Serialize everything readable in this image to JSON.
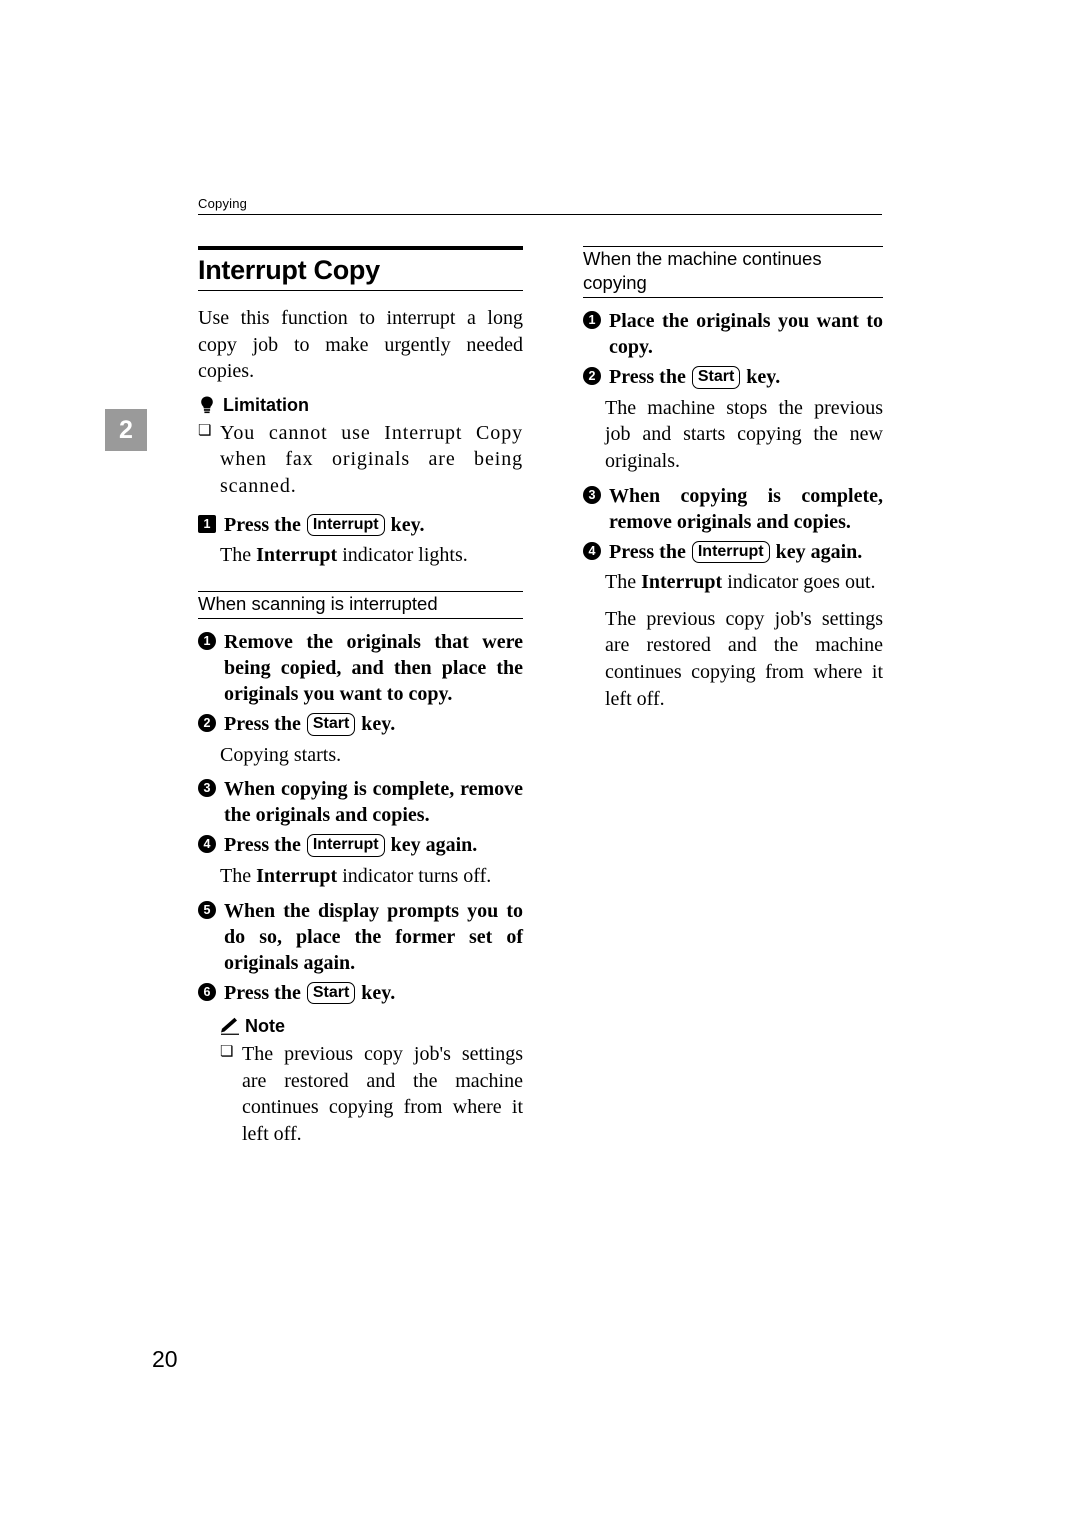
{
  "page": {
    "running_head": "Copying",
    "chapter_tab": "2",
    "page_number": "20"
  },
  "left_column": {
    "title": "Interrupt Copy",
    "intro": "Use this function to interrupt a long copy job to make urgently needed copies.",
    "limitation": {
      "icon": "limitation-bulb-icon",
      "heading": "Limitation",
      "items": [
        "You cannot use Interrupt Copy when fax originals are being scanned."
      ]
    },
    "step_main": {
      "marker": "1",
      "text_before_key": "Press the ",
      "key": "Interrupt",
      "text_after_key": " key."
    },
    "step_main_body_before": "The ",
    "step_main_body_bold": "Interrupt",
    "step_main_body_after": " indicator lights.",
    "section": {
      "heading": "When scanning is interrupted",
      "steps": [
        {
          "marker": "1",
          "text": "Remove the originals that were being copied, and then place the originals you want to copy."
        },
        {
          "marker": "2",
          "text_before_key": "Press the ",
          "key": "Start",
          "text_after_key": " key.",
          "body": "Copying starts."
        },
        {
          "marker": "3",
          "text": "When copying is complete, remove the originals and copies."
        },
        {
          "marker": "4",
          "text_before_key": "Press the ",
          "key": "Interrupt",
          "text_after_key": " key again.",
          "body_before": "The ",
          "body_bold": "Interrupt",
          "body_after": " indicator turns off."
        },
        {
          "marker": "5",
          "text": "When the display prompts you to do so, place the former set of originals again."
        },
        {
          "marker": "6",
          "text_before_key": "Press the ",
          "key": "Start",
          "text_after_key": " key."
        }
      ]
    },
    "note": {
      "icon": "note-pencil-icon",
      "heading": "Note",
      "items": [
        "The previous copy job's settings are restored and the machine continues copying from where it left off."
      ]
    }
  },
  "right_column": {
    "section": {
      "heading": "When the machine continues copying",
      "steps": [
        {
          "marker": "1",
          "text": "Place the originals you want to copy."
        },
        {
          "marker": "2",
          "text_before_key": "Press the ",
          "key": "Start",
          "text_after_key": " key.",
          "body": "The machine stops the previous job and starts copying the new originals."
        },
        {
          "marker": "3",
          "text": "When copying is complete, remove originals and copies."
        },
        {
          "marker": "4",
          "text_before_key": "Press the ",
          "key": "Interrupt",
          "text_after_key": " key again.",
          "body_before": "The ",
          "body_bold": "Interrupt",
          "body_after": " indicator goes out."
        }
      ],
      "closing_paragraph": "The previous copy job's settings are restored and the machine continues copying from where it left off."
    }
  }
}
